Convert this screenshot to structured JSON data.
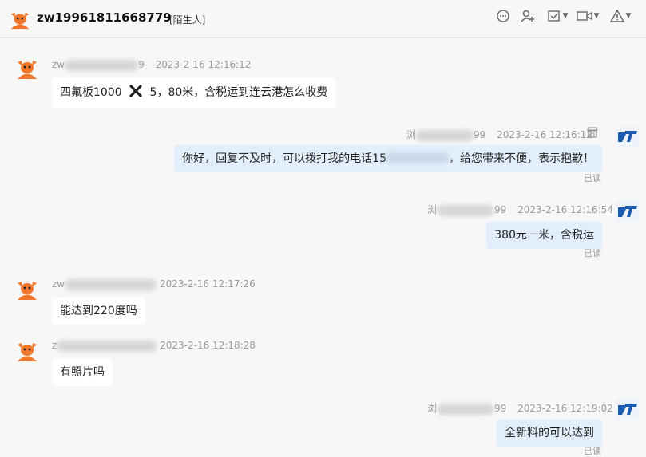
{
  "header": {
    "username": "zw19961811668779",
    "tag": "[陌生人]"
  },
  "toolbar": [
    {
      "name": "chat-bubble-icon"
    },
    {
      "name": "add-contact-icon"
    },
    {
      "name": "task-add-icon"
    },
    {
      "name": "video-call-icon"
    },
    {
      "name": "report-icon"
    }
  ],
  "messages": [
    {
      "side": "left",
      "name_start": "zw",
      "name_end": "9",
      "time": "2023-2-16 12:16:12",
      "text_part1": "四氟板1000",
      "text_part2": "5，80米，含税运到连云港怎么收费"
    },
    {
      "side": "right",
      "name_start": "浏",
      "name_end": "99",
      "time": "2023-2-16 12:16:12",
      "text_part1": "你好，回复不及时，可以拨打我的电话15",
      "text_part2": "，给您带来不便，表示抱歉！",
      "status": "已读"
    },
    {
      "side": "right",
      "name_start": "浏",
      "name_end": "99",
      "time": "2023-2-16 12:16:54",
      "text": "380元一米，含税运",
      "status": "已读"
    },
    {
      "side": "left",
      "name_start": "zw",
      "name_end": "",
      "time": "2023-2-16 12:17:26",
      "text": "能达到220度吗"
    },
    {
      "side": "left",
      "name_start": "z",
      "name_end": "",
      "time": "2023-2-16 12:18:28",
      "text": "有照片吗"
    },
    {
      "side": "right",
      "name_start": "浏",
      "name_end": "99",
      "time": "2023-2-16 12:19:02",
      "text": "全新料的可以达到",
      "status": "已读"
    }
  ],
  "colors": {
    "avatar_orange": "#f0772c",
    "bubble_right": "#e3eefc",
    "logo_blue": "#1a5bb0"
  }
}
